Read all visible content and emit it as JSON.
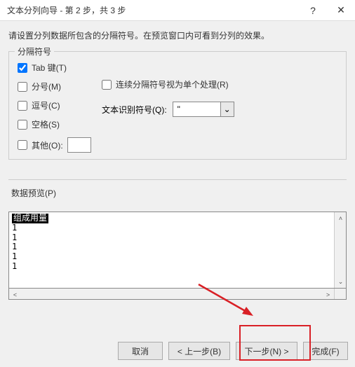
{
  "title": "文本分列向导 - 第 2 步，共 3 步",
  "instruction": "请设置分列数据所包含的分隔符号。在预览窗口内可看到分列的效果。",
  "delimiters": {
    "legend": "分隔符号",
    "tab": "Tab 键(T)",
    "semicolon": "分号(M)",
    "comma": "逗号(C)",
    "space": "空格(S)",
    "other": "其他(O):",
    "otherValue": "",
    "consecutive": "连续分隔符号视为单个处理(R)",
    "textQualLabel": "文本识别符号(Q):",
    "textQualValue": "\""
  },
  "preview": {
    "label": "数据预览(P)",
    "header": "组成用量",
    "r1": "1",
    "r2": "1",
    "r3": "1",
    "r4": "1",
    "r5": "1"
  },
  "buttons": {
    "cancel": "取消",
    "back": "< 上一步(B)",
    "next": "下一步(N) >",
    "finish": "完成(F)"
  },
  "icons": {
    "help": "?",
    "close": "✕",
    "down": "⌄",
    "up": "˄",
    "left": "˂",
    "right": "˃"
  }
}
